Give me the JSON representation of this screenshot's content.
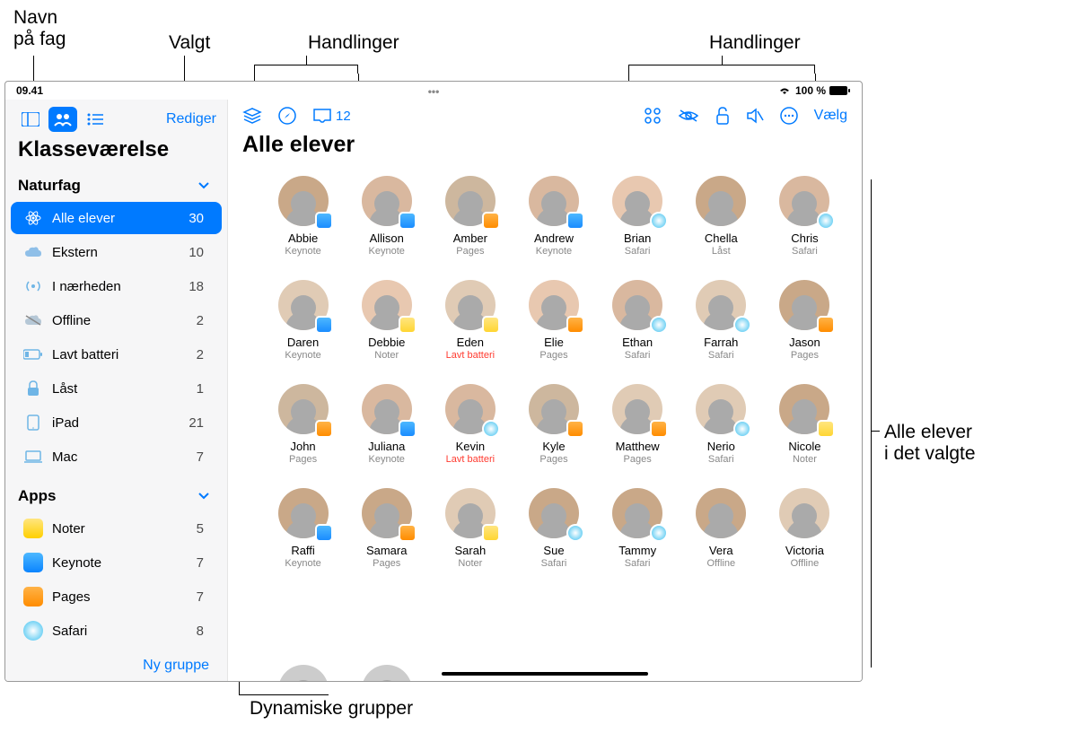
{
  "callouts": {
    "subject_name": "Navn\npå fag",
    "selected": "Valgt",
    "actions_left": "Handlinger",
    "actions_right": "Handlinger",
    "dynamic_groups": "Dynamiske grupper",
    "all_students_selected": "Alle elever\ni det valgte"
  },
  "status": {
    "time": "09.41",
    "battery": "100 %"
  },
  "sidebar": {
    "edit": "Rediger",
    "title": "Klasseværelse",
    "section1": "Naturfag",
    "items": [
      {
        "label": "Alle elever",
        "count": "30"
      },
      {
        "label": "Ekstern",
        "count": "10"
      },
      {
        "label": "I nærheden",
        "count": "18"
      },
      {
        "label": "Offline",
        "count": "2"
      },
      {
        "label": "Lavt batteri",
        "count": "2"
      },
      {
        "label": "Låst",
        "count": "1"
      },
      {
        "label": "iPad",
        "count": "21"
      },
      {
        "label": "Mac",
        "count": "7"
      }
    ],
    "section2": "Apps",
    "apps": [
      {
        "label": "Noter",
        "count": "5"
      },
      {
        "label": "Keynote",
        "count": "7"
      },
      {
        "label": "Pages",
        "count": "7"
      },
      {
        "label": "Safari",
        "count": "8"
      }
    ],
    "new_group": "Ny gruppe"
  },
  "main": {
    "inbox_count": "12",
    "select": "Vælg",
    "title": "Alle elever",
    "students": [
      {
        "name": "Abbie",
        "status": "Keynote",
        "badge": "keynote"
      },
      {
        "name": "Allison",
        "status": "Keynote",
        "badge": "keynote"
      },
      {
        "name": "Amber",
        "status": "Pages",
        "badge": "pages"
      },
      {
        "name": "Andrew",
        "status": "Keynote",
        "badge": "keynote"
      },
      {
        "name": "Brian",
        "status": "Safari",
        "badge": "safari"
      },
      {
        "name": "Chella",
        "status": "Låst",
        "badge": ""
      },
      {
        "name": "Chris",
        "status": "Safari",
        "badge": "safari"
      },
      {
        "name": "Daren",
        "status": "Keynote",
        "badge": "keynote"
      },
      {
        "name": "Debbie",
        "status": "Noter",
        "badge": "noter"
      },
      {
        "name": "Eden",
        "status": "Lavt batteri",
        "badge": "noter",
        "warn": true
      },
      {
        "name": "Elie",
        "status": "Pages",
        "badge": "pages"
      },
      {
        "name": "Ethan",
        "status": "Safari",
        "badge": "safari"
      },
      {
        "name": "Farrah",
        "status": "Safari",
        "badge": "safari"
      },
      {
        "name": "Jason",
        "status": "Pages",
        "badge": "pages"
      },
      {
        "name": "John",
        "status": "Pages",
        "badge": "pages"
      },
      {
        "name": "Juliana",
        "status": "Keynote",
        "badge": "keynote"
      },
      {
        "name": "Kevin",
        "status": "Lavt batteri",
        "badge": "safari",
        "warn": true
      },
      {
        "name": "Kyle",
        "status": "Pages",
        "badge": "pages"
      },
      {
        "name": "Matthew",
        "status": "Pages",
        "badge": "pages"
      },
      {
        "name": "Nerio",
        "status": "Safari",
        "badge": "safari"
      },
      {
        "name": "Nicole",
        "status": "Noter",
        "badge": "noter"
      },
      {
        "name": "Raffi",
        "status": "Keynote",
        "badge": "keynote"
      },
      {
        "name": "Samara",
        "status": "Pages",
        "badge": "pages"
      },
      {
        "name": "Sarah",
        "status": "Noter",
        "badge": "noter"
      },
      {
        "name": "Sue",
        "status": "Safari",
        "badge": "safari"
      },
      {
        "name": "Tammy",
        "status": "Safari",
        "badge": "safari"
      },
      {
        "name": "Vera",
        "status": "Offline",
        "badge": ""
      },
      {
        "name": "Victoria",
        "status": "Offline",
        "badge": ""
      }
    ]
  }
}
